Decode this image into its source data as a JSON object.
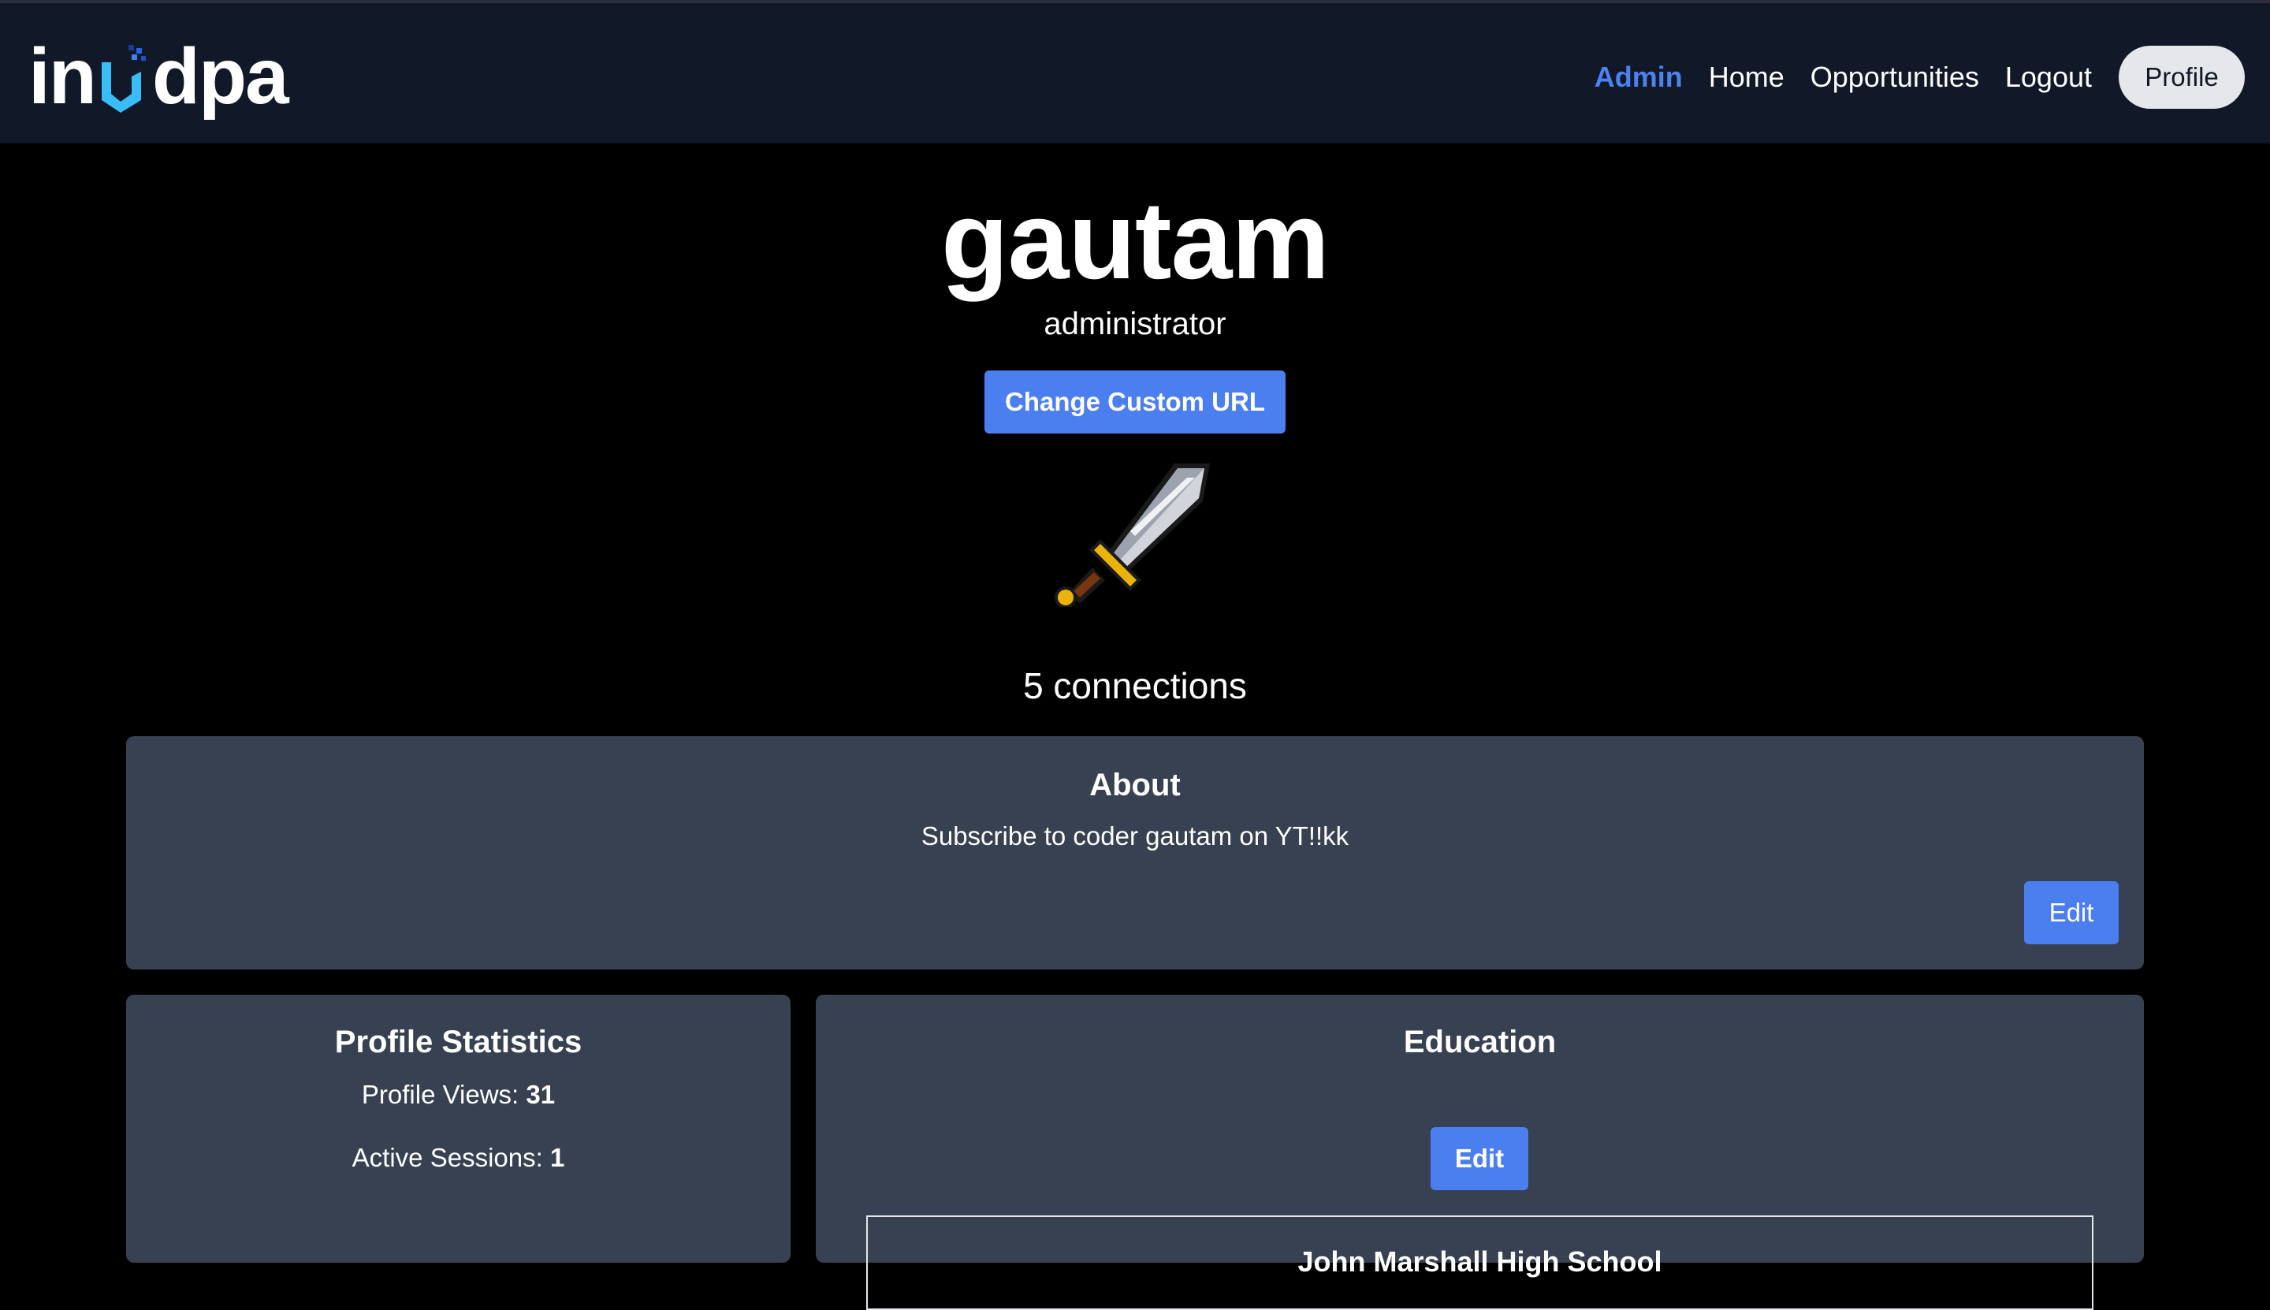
{
  "nav": {
    "logo_left": "in",
    "logo_right": "dpa",
    "links": [
      {
        "label": "Admin",
        "active": true
      },
      {
        "label": "Home",
        "active": false
      },
      {
        "label": "Opportunities",
        "active": false
      },
      {
        "label": "Logout",
        "active": false
      }
    ],
    "profile_label": "Profile"
  },
  "profile": {
    "username": "gautam",
    "role": "administrator",
    "custom_url_label": "Change Custom URL",
    "avatar_icon": "sword-icon",
    "connections": "5 connections"
  },
  "about": {
    "title": "About",
    "text": "Subscribe to coder gautam on YT!!kk",
    "edit_label": "Edit"
  },
  "stats": {
    "title": "Profile Statistics",
    "views_label": "Profile Views: ",
    "views_value": "31",
    "sessions_label": "Active Sessions: ",
    "sessions_value": "1"
  },
  "education": {
    "title": "Education",
    "edit_label": "Edit",
    "entries": [
      {
        "school": "John Marshall High School"
      }
    ]
  },
  "colors": {
    "accent": "#4b7ff0",
    "navbar_bg": "#111827",
    "card_bg": "#374151",
    "page_bg": "#000000"
  }
}
